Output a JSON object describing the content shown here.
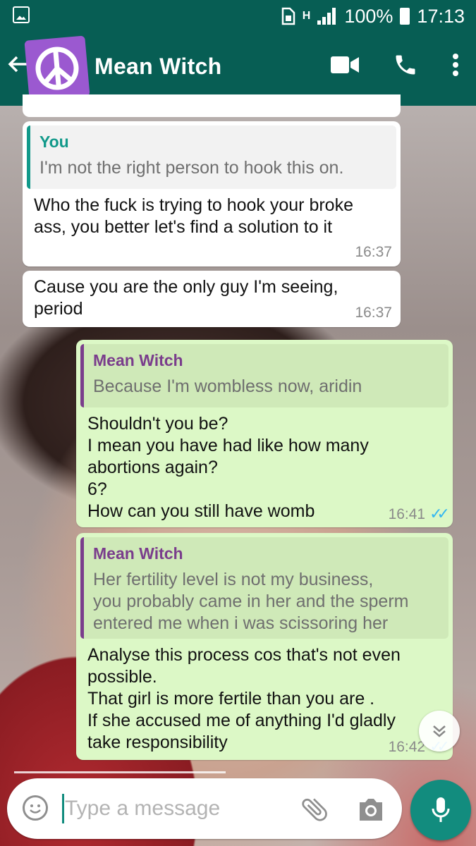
{
  "status_bar": {
    "network": "H",
    "battery": "100%",
    "time": "17:13"
  },
  "header": {
    "contact_name": "Mean Witch"
  },
  "messages": [
    {
      "direction": "incoming",
      "quote_author": "You",
      "quote_text": "I'm not the right person to hook this on.",
      "text": "Who the fuck is trying to hook your broke\nass, you better let's find a solution to it",
      "time": "16:37"
    },
    {
      "direction": "incoming",
      "text": "Cause you are the only guy I'm seeing,\nperiod",
      "time": "16:37"
    },
    {
      "direction": "outgoing",
      "quote_author": "Mean Witch",
      "quote_text": "Because I'm wombless now, aridin",
      "text": "Shouldn't you be?\nI mean you have had like how many\nabortions again?\n6?\nHow can you still have womb",
      "time": "16:41",
      "status": "read"
    },
    {
      "direction": "outgoing",
      "quote_author": "Mean Witch",
      "quote_text": "Her fertility level is not my business,\nyou probably came in her and the sperm\nentered me when i was scissoring her",
      "text": "Analyse this process cos that's not even\npossible.\nThat girl is more fertile than you are .\nIf she accused me of anything I'd gladly\ntake responsibility",
      "time": "16:42",
      "status": "read"
    }
  ],
  "input": {
    "placeholder": "Type a message"
  },
  "colors": {
    "header": "#075e54",
    "outgoing_bubble": "#dcf8c6",
    "incoming_bubble": "#ffffff",
    "accent": "#128c7e",
    "read_ticks": "#34b7f1"
  }
}
